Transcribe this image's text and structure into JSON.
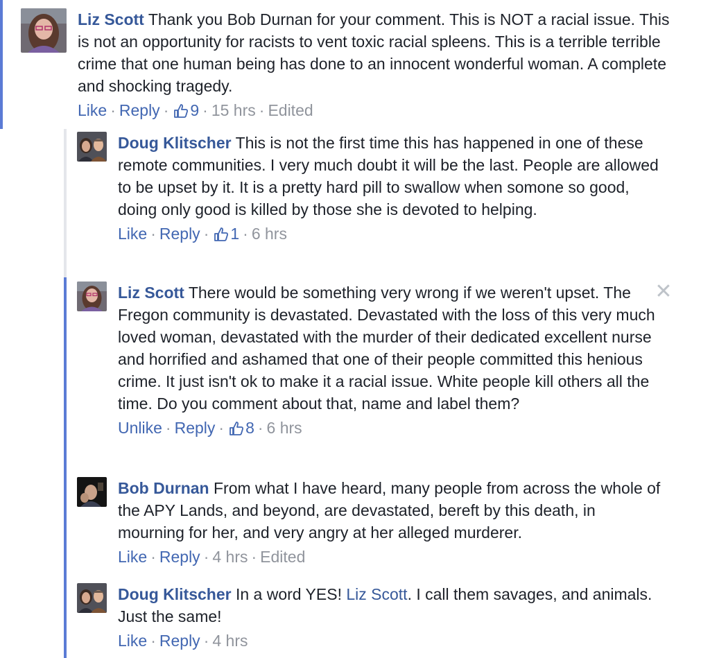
{
  "comments": [
    {
      "author": "Liz Scott",
      "text": "Thank you Bob Durnan for your comment. This is NOT a racial issue. This is not an opportunity for racists to vent toxic racial spleens. This is a terrible terrible crime that one human being has done to an innocent wonderful woman. A complete and shocking tragedy.",
      "like_label": "Like",
      "reply_label": "Reply",
      "like_count": "9",
      "time": "15 hrs",
      "edited": "Edited"
    },
    {
      "author": "Doug Klitscher",
      "text": "This is not the first time this has happened in one of these remote communities. I very much doubt it will be the last. People are allowed to be upset by it. It is a pretty hard pill to swallow when somone so good, doing only good is killed by those she is devoted to helping.",
      "like_label": "Like",
      "reply_label": "Reply",
      "like_count": "1",
      "time": "6 hrs"
    },
    {
      "author": "Liz Scott",
      "text": "There would be something very wrong if we weren't upset. The Fregon community is devastated. Devastated with the loss of this very much loved woman, devastated with the murder of their dedicated excellent nurse and horrified and ashamed that one of their people committed this henious crime. It just isn't ok to make it a racial issue. White people kill others all the time. Do you comment about that, name and label them?",
      "like_label": "Unlike",
      "reply_label": "Reply",
      "like_count": "8",
      "time": "6 hrs"
    },
    {
      "author": "Bob Durnan",
      "text": "From what I have heard, many people from across the whole of the APY Lands, and beyond, are devastated, bereft by this death, in mourning for her, and very angry at her alleged murderer.",
      "like_label": "Like",
      "reply_label": "Reply",
      "time": "4 hrs",
      "edited": "Edited"
    },
    {
      "author": "Doug Klitscher",
      "text_before": "In a word YES!",
      "mention": "Liz Scott",
      "text_after": ". I call them savages, and animals. Just the same!",
      "like_label": "Like",
      "reply_label": "Reply",
      "time": "4 hrs"
    }
  ],
  "separator": "·",
  "close_glyph": "✕",
  "colors": {
    "link": "#4267b2",
    "author": "#365899",
    "meta": "#90949c",
    "accent_rail": "#5b7bd5"
  }
}
